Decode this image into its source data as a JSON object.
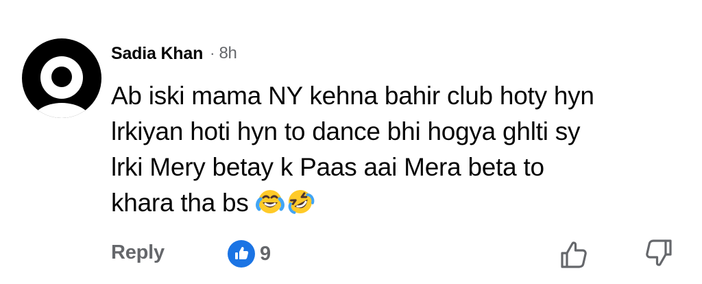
{
  "comment": {
    "author": "Sadia Khan",
    "separator": "·",
    "time": "8h",
    "text": "Ab iski mama NY kehna bahir club hoty hyn\nlrkiyan hoti hyn to dance bhi hogya ghlti sy\nlrki Mery betay k Paas aai Mera beta to\nkhara tha bs",
    "emojis": [
      "face-with-tears-of-joy-icon",
      "rolling-on-the-floor-laughing-icon"
    ]
  },
  "actions": {
    "reply_label": "Reply",
    "like_count": "9",
    "like_icon": "like-icon",
    "upvote_icon": "thumb-up-icon",
    "downvote_icon": "thumb-down-icon"
  },
  "colors": {
    "primary_text": "#050505",
    "secondary_text": "#65676b",
    "like_blue": "#1b74e4",
    "avatar": "#000000"
  }
}
